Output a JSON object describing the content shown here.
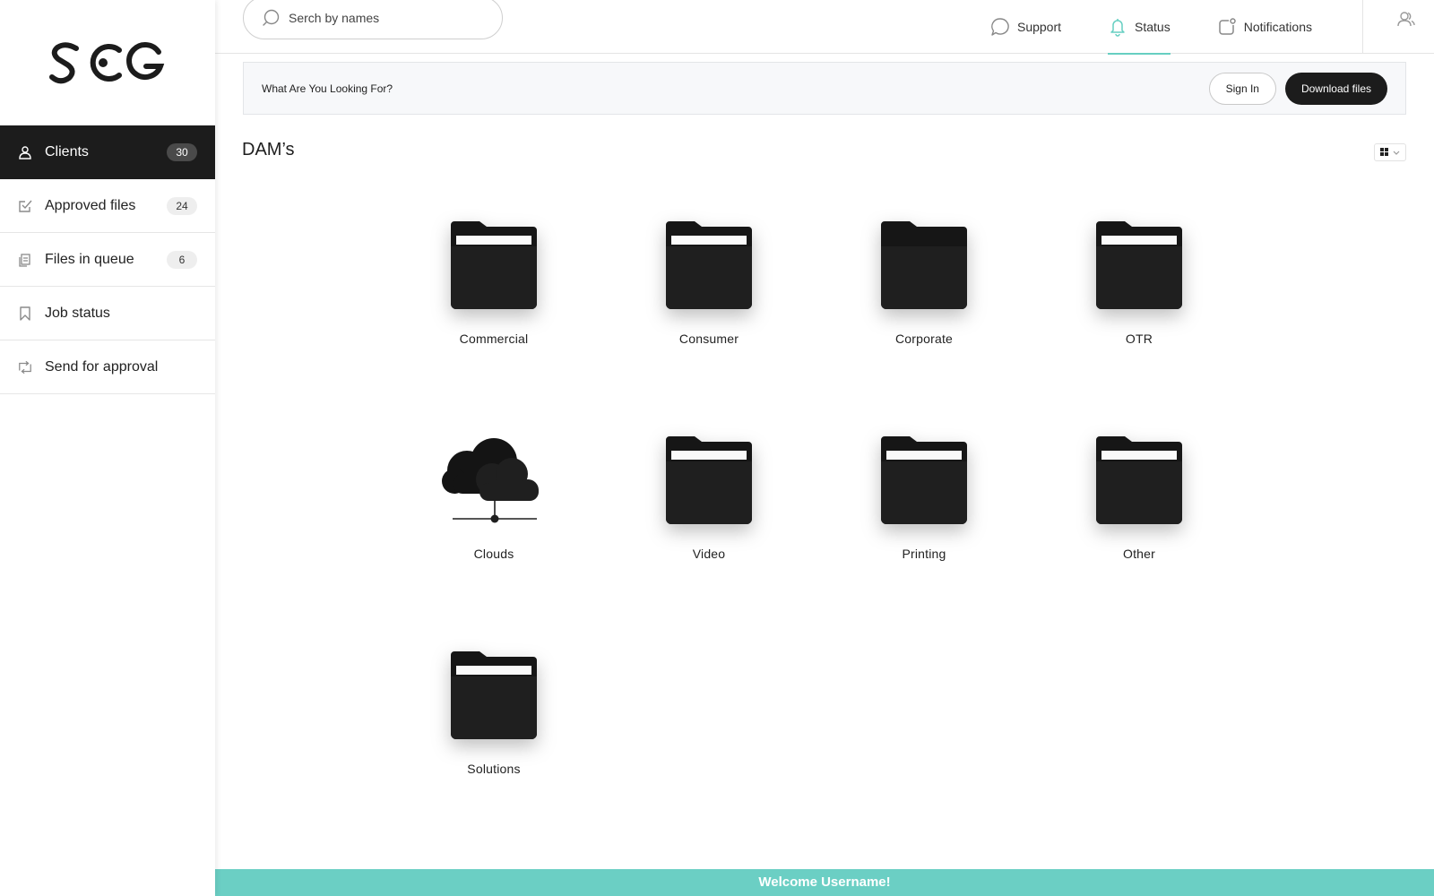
{
  "brand": {
    "logo_text": "SCG"
  },
  "sidebar": {
    "items": [
      {
        "label": "Clients",
        "badge": "30",
        "icon": "user-icon",
        "active": true
      },
      {
        "label": "Approved files",
        "badge": "24",
        "icon": "checkbox-icon",
        "active": false
      },
      {
        "label": "Files in queue",
        "badge": "6",
        "icon": "files-icon",
        "active": false
      },
      {
        "label": "Job status",
        "badge": "",
        "icon": "bookmark-icon",
        "active": false
      },
      {
        "label": "Send for approval",
        "badge": "",
        "icon": "send-icon",
        "active": false
      }
    ]
  },
  "topbar": {
    "search_placeholder": "Serch by names",
    "links": [
      {
        "label": "Support",
        "icon": "chat-bubble-icon",
        "active": false
      },
      {
        "label": "Status",
        "icon": "bell-icon",
        "active": true
      },
      {
        "label": "Notifications",
        "icon": "notification-icon",
        "active": false
      }
    ],
    "user_icon": "users-icon"
  },
  "banner": {
    "prompt": "What Are You Looking For?",
    "sign_in_label": "Sign In",
    "download_label": "Download files"
  },
  "main": {
    "title": "DAM’s",
    "view_mode_icon": "grid-view-icon",
    "tiles": [
      {
        "label": "Commercial",
        "icon": "folder-icon"
      },
      {
        "label": "Consumer",
        "icon": "folder-icon"
      },
      {
        "label": "Corporate",
        "icon": "folder-empty-icon"
      },
      {
        "label": "OTR",
        "icon": "folder-icon"
      },
      {
        "label": "Clouds",
        "icon": "cloud-network-icon"
      },
      {
        "label": "Video",
        "icon": "folder-icon"
      },
      {
        "label": "Printing",
        "icon": "folder-icon"
      },
      {
        "label": "Other",
        "icon": "folder-icon"
      },
      {
        "label": "Solutions",
        "icon": "folder-icon"
      }
    ]
  },
  "footer": {
    "welcome": "Welcome Username!"
  },
  "colors": {
    "accent": "#66cfc2",
    "dark": "#1c1c1c",
    "footer": "#6bcfc4"
  }
}
